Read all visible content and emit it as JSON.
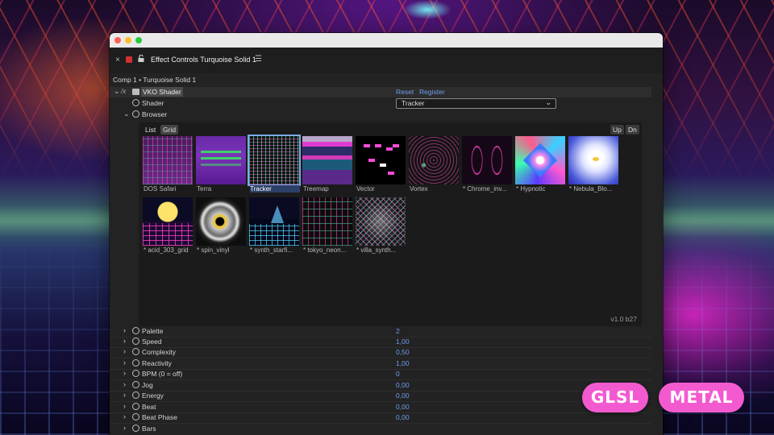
{
  "panel": {
    "close_glyph": "×",
    "lock_glyph": "🔓",
    "title": "Effect Controls Turquoise Solid 1",
    "menu_glyph": "☰",
    "comp_line": "Comp 1 • Turquoise Solid 1"
  },
  "effect": {
    "fx_label": "/x",
    "name": "VKO Shader",
    "reset_label": "Reset",
    "register_label": "Register"
  },
  "shader": {
    "label": "Shader",
    "value": "Tracker"
  },
  "browser": {
    "label": "Browser",
    "list_label": "List",
    "grid_label": "Grid",
    "up_label": "Up",
    "dn_label": "Dn",
    "version": "v1.0 b27",
    "thumbnails_row1": [
      {
        "name": "DOS Safari"
      },
      {
        "name": "Terra"
      },
      {
        "name": "Tracker"
      },
      {
        "name": "Treemap"
      },
      {
        "name": "Vector"
      },
      {
        "name": "Vortex"
      },
      {
        "name": "* Chrome_inv..."
      },
      {
        "name": "* Hypnotic"
      },
      {
        "name": "* Nebula_Blo..."
      }
    ],
    "thumbnails_row2": [
      {
        "name": "* acid_303_grid"
      },
      {
        "name": "* spin_vinyl"
      },
      {
        "name": "* synth_starfi..."
      },
      {
        "name": "* tokyo_neon..."
      },
      {
        "name": "* villa_synth..."
      }
    ],
    "selected": "Tracker"
  },
  "params": [
    {
      "label": "Palette",
      "value": "2"
    },
    {
      "label": "Speed",
      "value": "1,00"
    },
    {
      "label": "Complexity",
      "value": "0,50"
    },
    {
      "label": "Reactivity",
      "value": "1,00"
    },
    {
      "label": "BPM (0 = off)",
      "value": "0"
    },
    {
      "label": "Jog",
      "value": "0,00"
    },
    {
      "label": "Energy",
      "value": "0,00"
    },
    {
      "label": "Beat",
      "value": "0,00"
    },
    {
      "label": "Beat Phase",
      "value": "0,00"
    },
    {
      "label": "Bars",
      "value": ""
    }
  ],
  "badges": {
    "glsl": "GLSL",
    "metal": "METAL"
  },
  "colors": {
    "accent_blue": "#6f9dee",
    "pill_pink": "#f45ad0",
    "panel_bg": "#232323"
  }
}
